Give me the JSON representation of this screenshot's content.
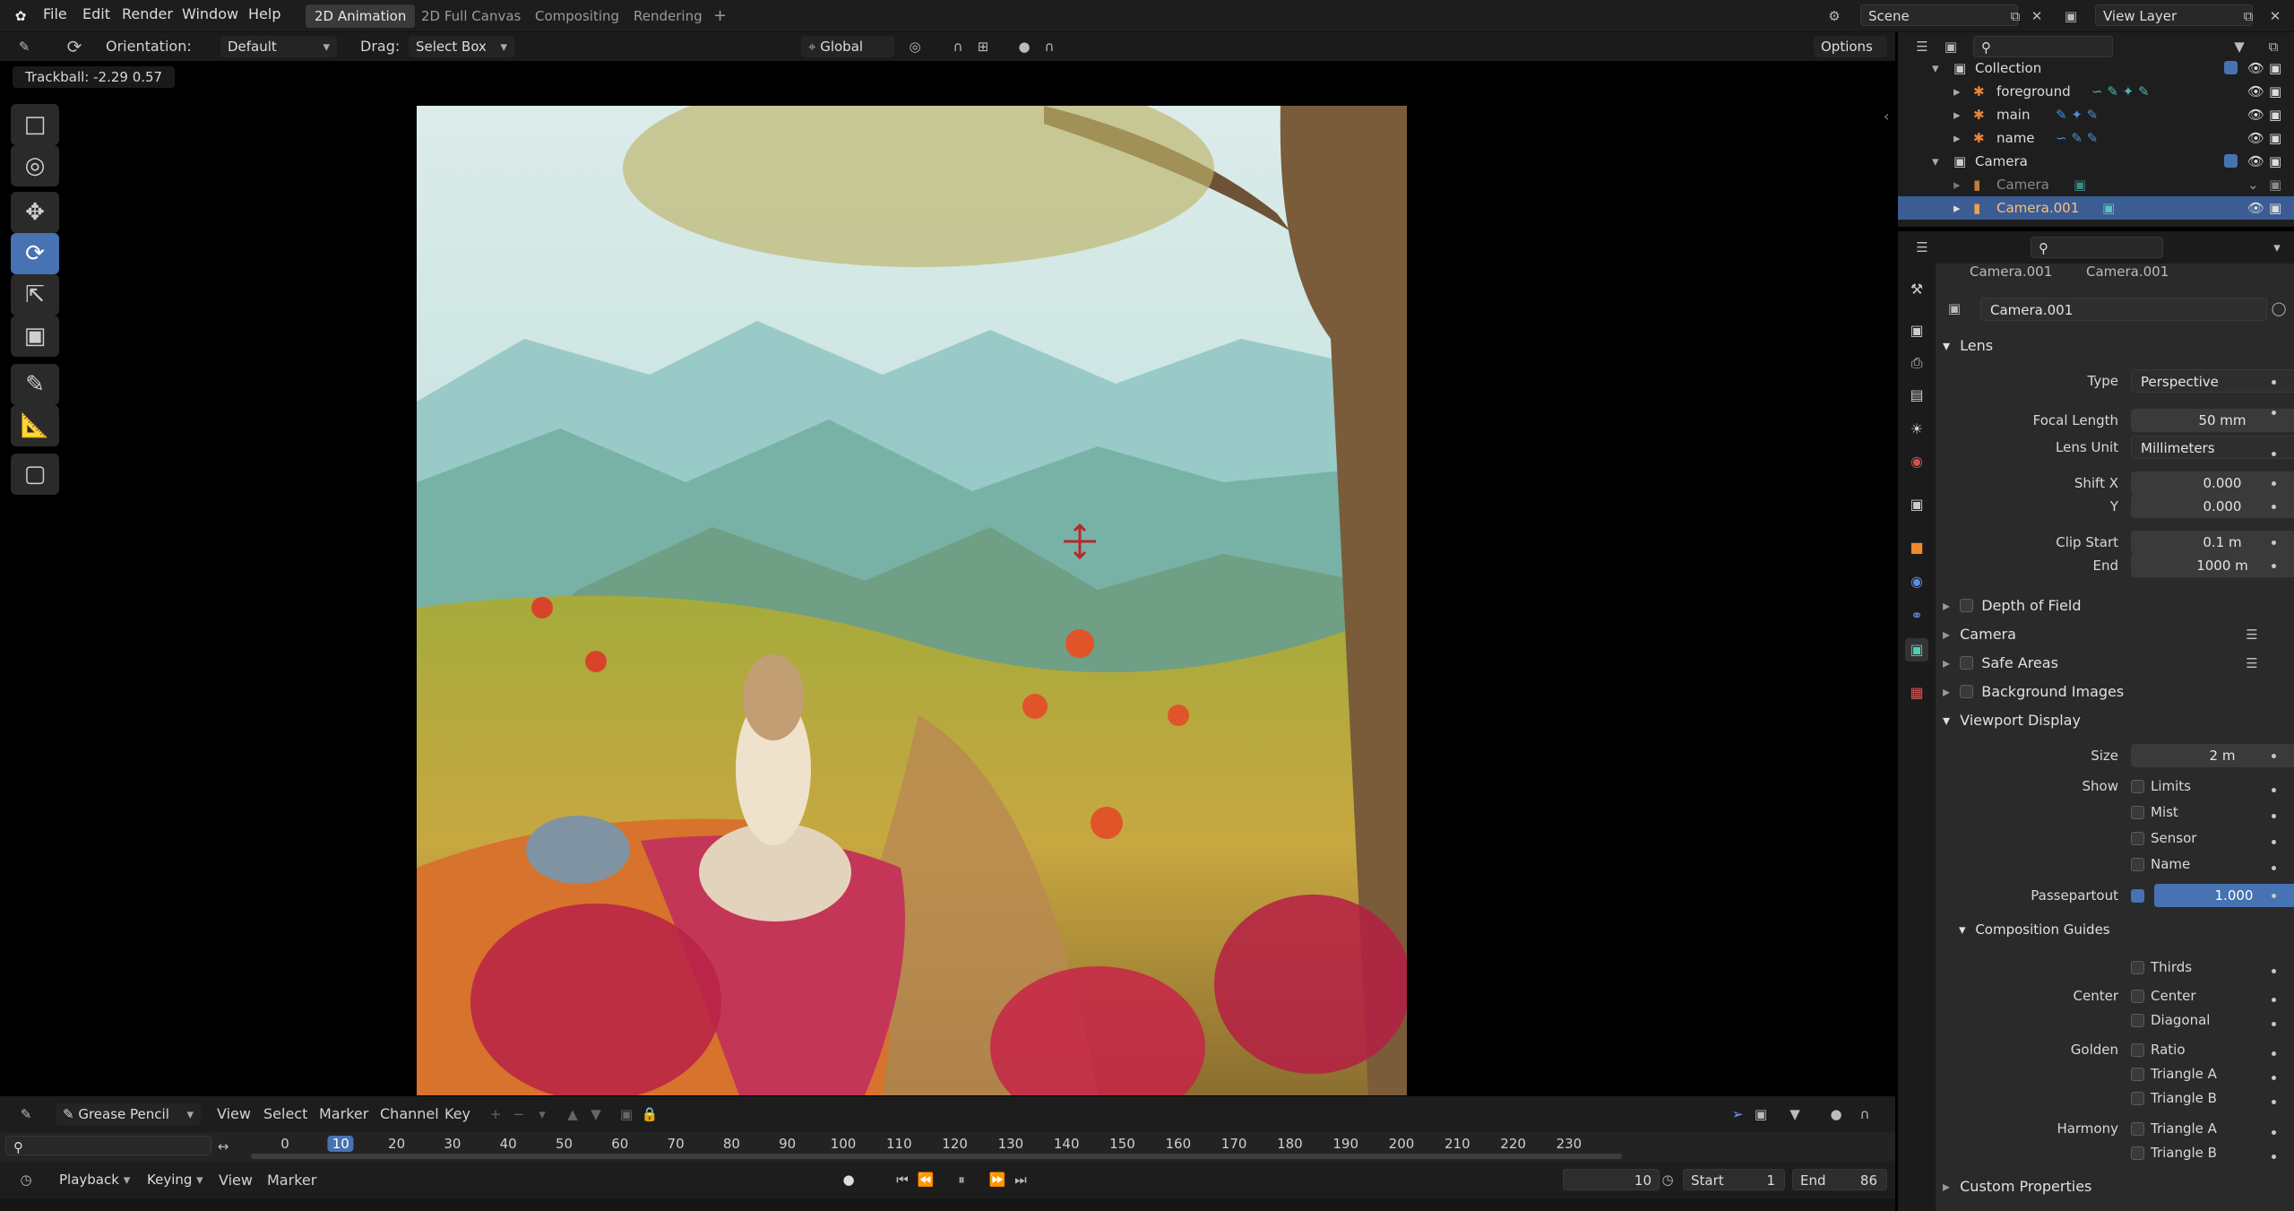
{
  "topbar": {
    "menus": [
      "File",
      "Edit",
      "Render",
      "Window",
      "Help"
    ],
    "workspaces": [
      "2D Animation",
      "2D Full Canvas",
      "Compositing",
      "Rendering"
    ],
    "add_tab": "+",
    "scene": "Scene",
    "view_layer": "View Layer"
  },
  "viewport_header": {
    "orientation_label": "Orientation:",
    "orientation_value": "Default",
    "drag_label": "Drag:",
    "drag_value": "Select Box",
    "transform_space": "Global",
    "options": "Options"
  },
  "viewport": {
    "tracker": "Trackball: -2.29 0.57"
  },
  "outliner": {
    "rows": [
      {
        "label": "Collection",
        "type": "collection"
      },
      {
        "label": "foreground",
        "type": "gpencil"
      },
      {
        "label": "main",
        "type": "gpencil"
      },
      {
        "label": "name",
        "type": "gpencil"
      },
      {
        "label": "Camera",
        "type": "collection"
      },
      {
        "label": "Camera",
        "type": "camera"
      },
      {
        "label": "Camera.001",
        "type": "camera"
      }
    ]
  },
  "properties": {
    "breadcrumb_object": "Camera.001",
    "breadcrumb_data": "Camera.001",
    "datablock": "Camera.001",
    "lens_section": "Lens",
    "type_label": "Type",
    "type_value": "Perspective",
    "focal_label": "Focal Length",
    "focal_value": "50 mm",
    "lens_unit_label": "Lens Unit",
    "lens_unit_value": "Millimeters",
    "shiftx_label": "Shift X",
    "shiftx_value": "0.000",
    "shifty_label": "Y",
    "shifty_value": "0.000",
    "clip_start_label": "Clip Start",
    "clip_start_value": "0.1 m",
    "clip_end_label": "End",
    "clip_end_value": "1000 m",
    "dof": "Depth of Field",
    "camera": "Camera",
    "safe_areas": "Safe Areas",
    "bg_images": "Background Images",
    "viewport_display": "Viewport Display",
    "size_label": "Size",
    "size_value": "2 m",
    "show_label": "Show",
    "limits": "Limits",
    "mist": "Mist",
    "sensor": "Sensor",
    "name": "Name",
    "passepartout_label": "Passepartout",
    "passepartout_value": "1.000",
    "comp_guides": "Composition Guides",
    "thirds": "Thirds",
    "center_label": "Center",
    "center": "Center",
    "diagonal": "Diagonal",
    "golden_label": "Golden",
    "ratio": "Ratio",
    "triangle_a": "Triangle A",
    "triangle_b": "Triangle B",
    "harmony_label": "Harmony",
    "harmony_a": "Triangle A",
    "harmony_b": "Triangle B",
    "custom_props": "Custom Properties"
  },
  "timeline": {
    "mode": "Grease Pencil",
    "menus": [
      "View",
      "Select",
      "Marker",
      "Channel",
      "Key"
    ],
    "ticks": [
      "0",
      "10",
      "20",
      "30",
      "40",
      "50",
      "60",
      "70",
      "80",
      "90",
      "100",
      "110",
      "120",
      "130",
      "140",
      "150",
      "160",
      "170",
      "180",
      "190",
      "200",
      "210",
      "220",
      "230"
    ],
    "current_frame": "10",
    "playback": "Playback",
    "keying": "Keying",
    "view": "View",
    "marker": "Marker",
    "frame_value": "10",
    "start_label": "Start",
    "start_value": "1",
    "end_label": "End",
    "end_value": "86"
  }
}
